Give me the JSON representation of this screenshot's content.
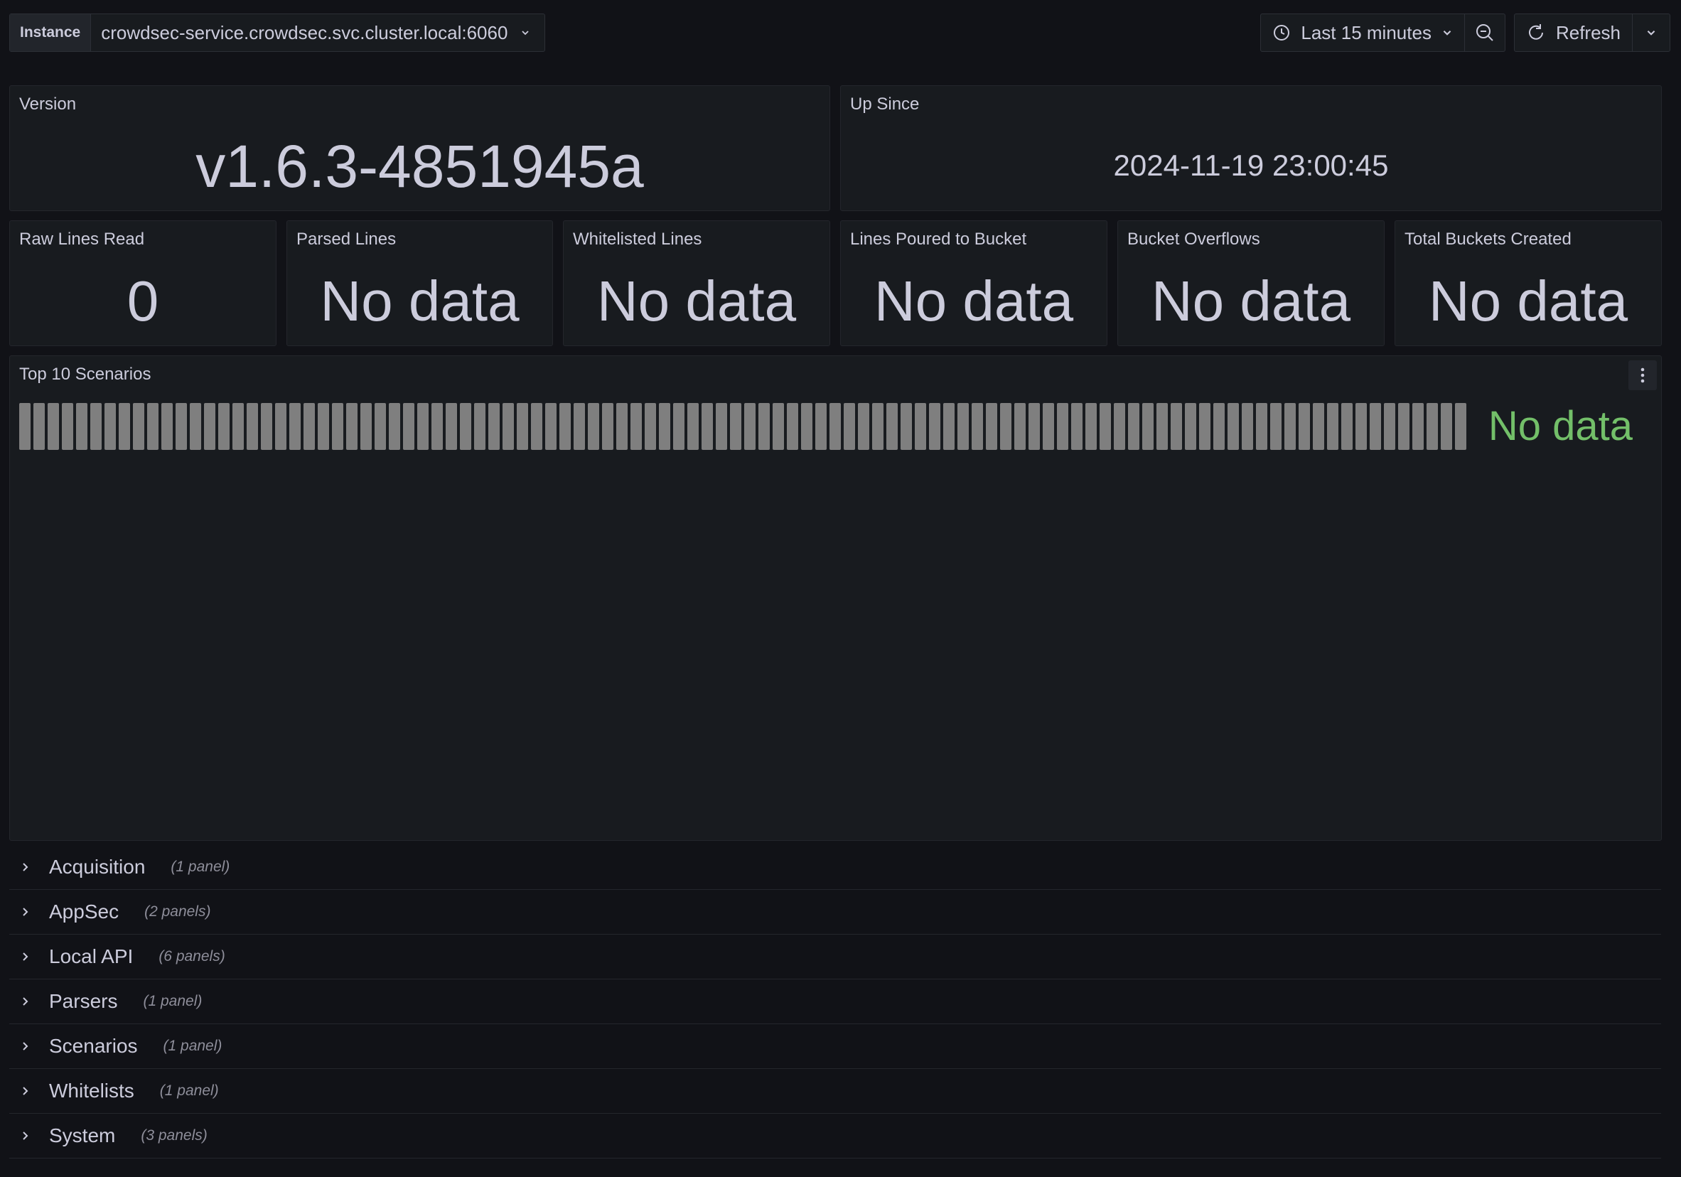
{
  "toolbar": {
    "variable_label": "Instance",
    "variable_value": "crowdsec-service.crowdsec.svc.cluster.local:6060",
    "time_range": "Last 15 minutes",
    "refresh_label": "Refresh"
  },
  "panels": {
    "version": {
      "title": "Version",
      "value": "v1.6.3-4851945a"
    },
    "up_since": {
      "title": "Up Since",
      "value": "2024-11-19 23:00:45"
    },
    "raw_lines": {
      "title": "Raw Lines Read",
      "value": "0"
    },
    "parsed_lines": {
      "title": "Parsed Lines",
      "value": "No data"
    },
    "whitelisted_lines": {
      "title": "Whitelisted Lines",
      "value": "No data"
    },
    "lines_poured": {
      "title": "Lines Poured to Bucket",
      "value": "No data"
    },
    "bucket_overflows": {
      "title": "Bucket Overflows",
      "value": "No data"
    },
    "total_buckets": {
      "title": "Total Buckets Created",
      "value": "No data"
    },
    "top_scenarios": {
      "title": "Top 10 Scenarios",
      "value": "No data"
    }
  },
  "rows": [
    {
      "title": "Acquisition",
      "count": "(1 panel)"
    },
    {
      "title": "AppSec",
      "count": "(2 panels)"
    },
    {
      "title": "Local API",
      "count": "(6 panels)"
    },
    {
      "title": "Parsers",
      "count": "(1 panel)"
    },
    {
      "title": "Scenarios",
      "count": "(1 panel)"
    },
    {
      "title": "Whitelists",
      "count": "(1 panel)"
    },
    {
      "title": "System",
      "count": "(3 panels)"
    }
  ],
  "colors": {
    "background": "#111217",
    "panel": "#181b1f",
    "text": "#ccccdc",
    "nodata_green": "#73bf69",
    "bar_gray": "#7f7f7f"
  }
}
